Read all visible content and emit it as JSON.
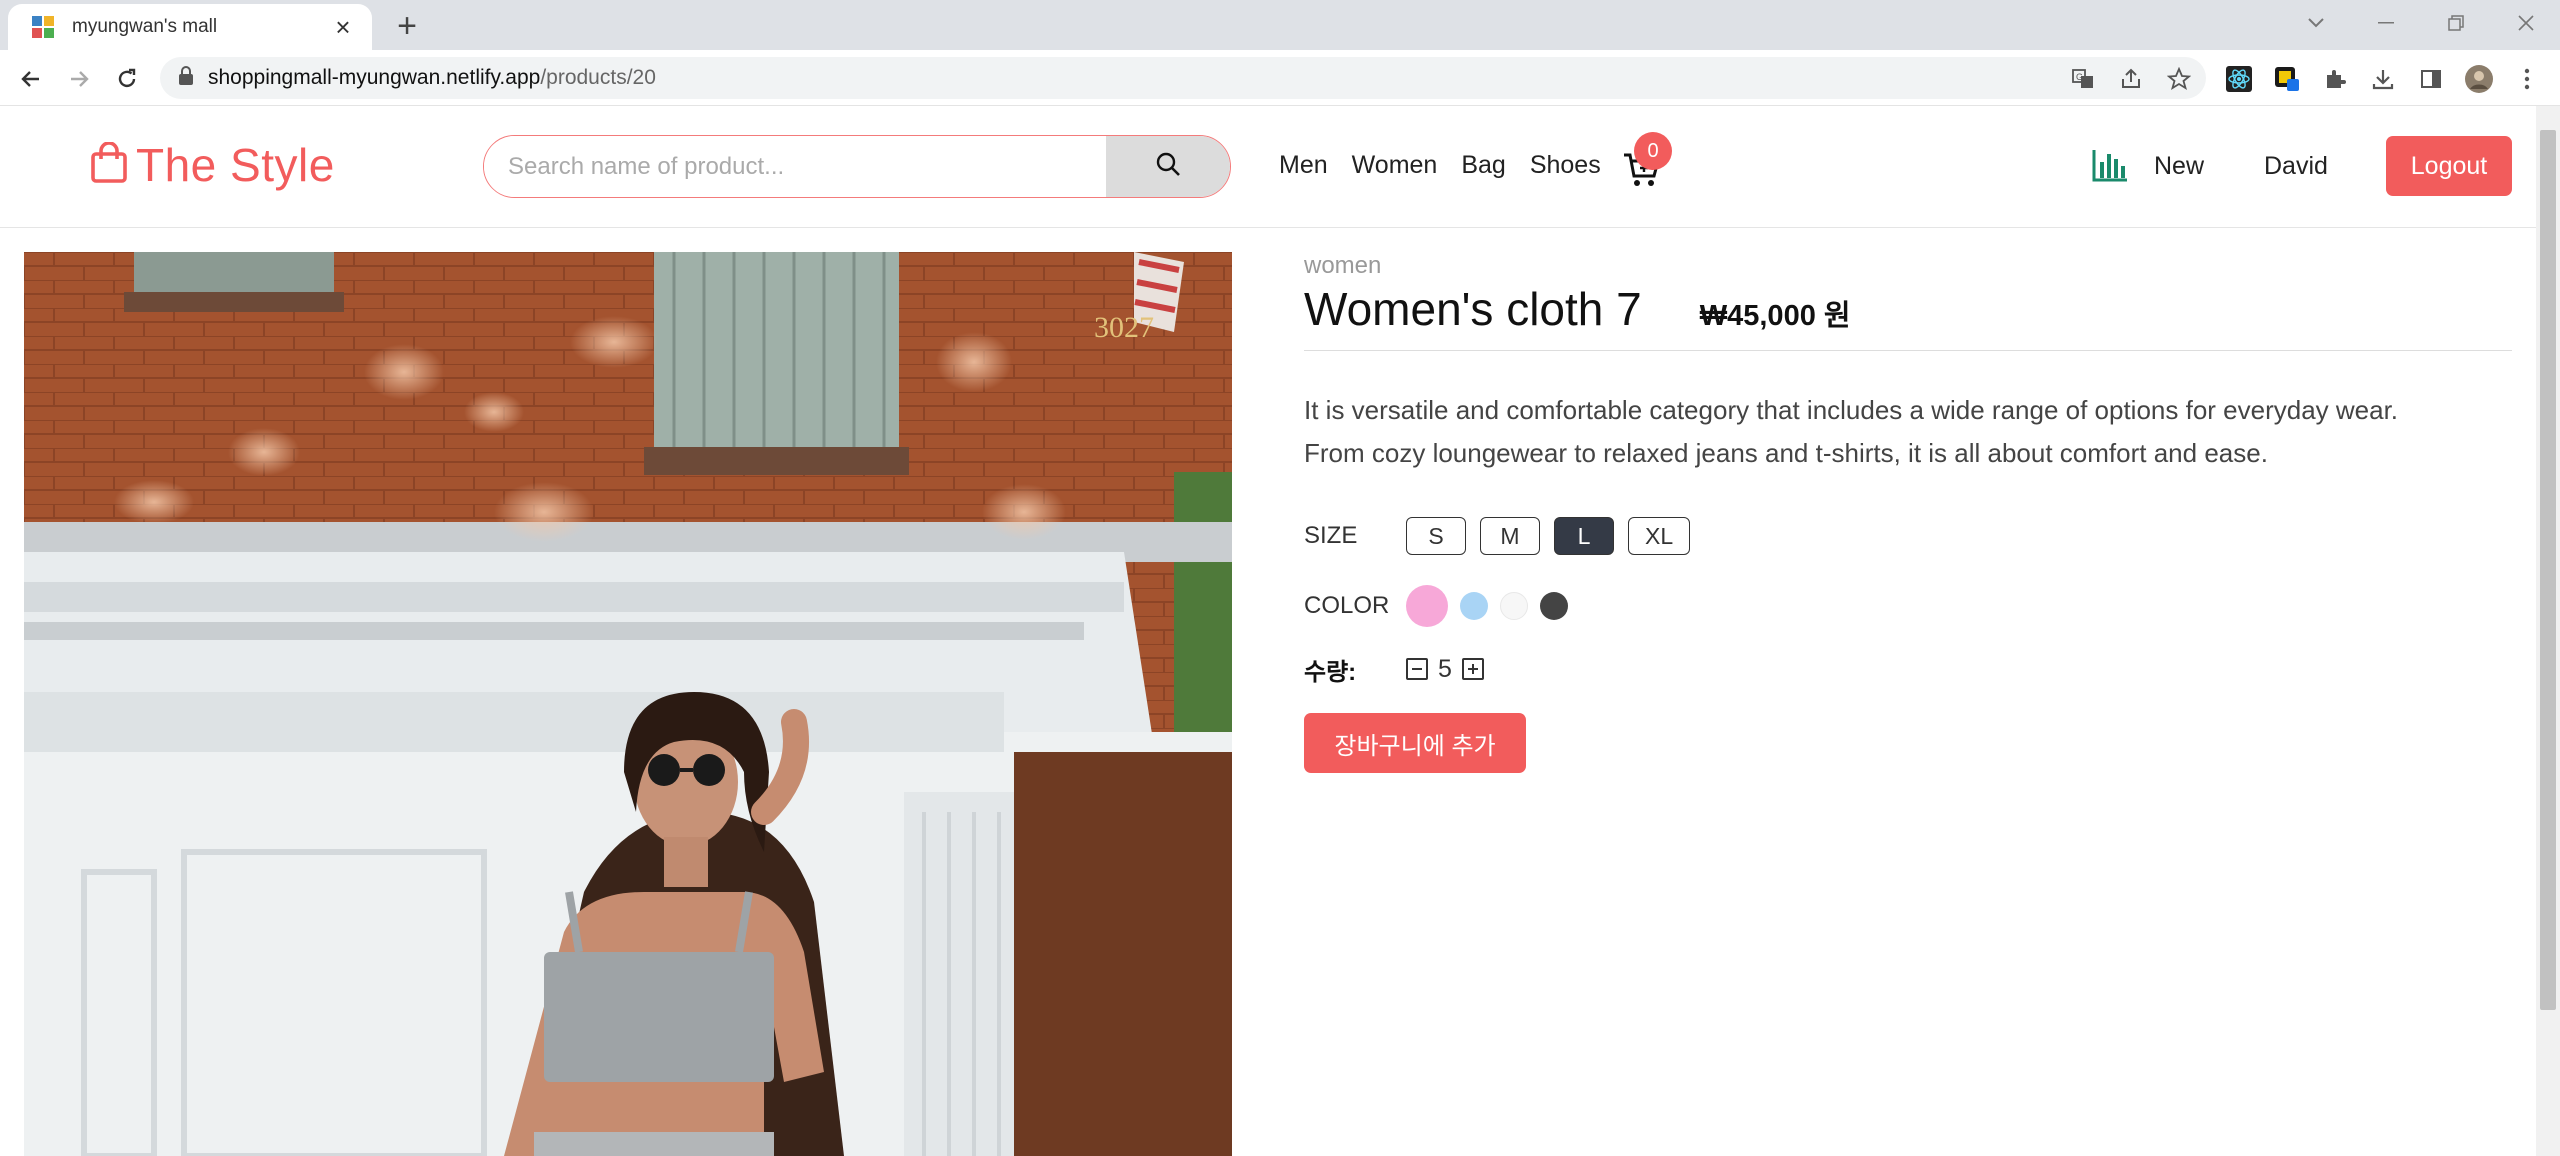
{
  "browser": {
    "tab_title": "myungwan's mall",
    "tab_close": "×",
    "new_tab": "+",
    "url_host": "shoppingmall-myungwan.netlify.app",
    "url_path": "/products/20"
  },
  "header": {
    "logo_text": "The Style",
    "search_placeholder": "Search name of product...",
    "nav": [
      "Men",
      "Women",
      "Bag",
      "Shoes"
    ],
    "cart_count": "0",
    "new_label": "New",
    "user_name": "David",
    "logout_label": "Logout"
  },
  "product": {
    "category": "women",
    "name": "Women's cloth 7",
    "price": "₩45,000 원",
    "description_line1": "It is versatile and comfortable category that includes a wide range of options for everyday wear.",
    "description_line2": "From cozy loungewear to relaxed jeans and t-shirts, it is all about comfort and ease.",
    "size_label": "SIZE",
    "sizes": [
      "S",
      "M",
      "L",
      "XL"
    ],
    "selected_size": "L",
    "color_label": "COLOR",
    "colors": [
      "#f7a8d8",
      "#a9d4f5",
      "#f7f7f7",
      "#444444"
    ],
    "selected_color": "#f7a8d8",
    "quantity_label": "수량:",
    "quantity": "5",
    "add_to_cart_label": "장바구니에 추가"
  },
  "theme": {
    "accent": "#f25c5c",
    "selected_size_bg": "#343a46"
  }
}
